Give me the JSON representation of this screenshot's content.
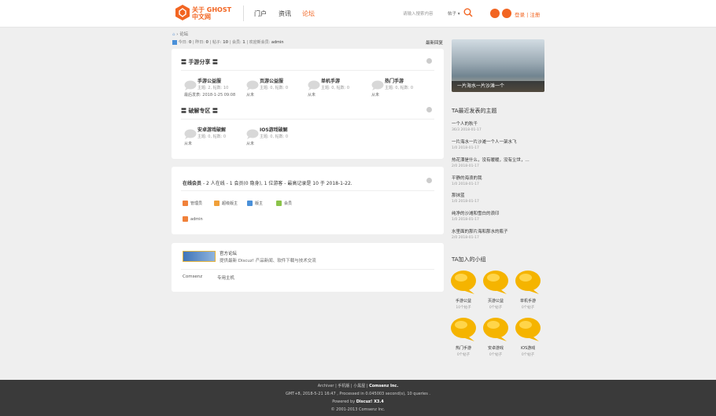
{
  "header": {
    "logo_line1": "关于 GHOST",
    "logo_line2": "中文网",
    "nav": [
      "门户",
      "资讯",
      "论坛"
    ],
    "search_placeholder": "请输入搜索内容",
    "search_scope": "帖子",
    "login": "登录",
    "register": "注册"
  },
  "breadcrumb": {
    "current": "论坛"
  },
  "stats": {
    "today_label": "今日:",
    "today": "0",
    "yesterday_label": "昨日:",
    "yesterday": "0",
    "posts_label": "帖子:",
    "posts": "10",
    "members_label": "会员:",
    "members": "1",
    "welcome_label": "欢迎新会员:",
    "newest": "admin"
  },
  "latest_reply": "最新回复",
  "categories": [
    {
      "title": "手游分享",
      "forums": [
        {
          "name": "手游公益服",
          "stat": "主题: 2, 帖数: 10",
          "extra": "最后发表: 2018-1-25 09:08"
        },
        {
          "name": "页游公益服",
          "stat": "主题: 0, 帖数: 0",
          "extra": "从未"
        },
        {
          "name": "单机手游",
          "stat": "主题: 0, 帖数: 0",
          "extra": "从未"
        },
        {
          "name": "热门手游",
          "stat": "主题: 0, 帖数: 0",
          "extra": "从未"
        }
      ]
    },
    {
      "title": "破解专区",
      "forums": [
        {
          "name": "安卓游戏破解",
          "stat": "主题: 0, 帖数: 0",
          "extra": "从未"
        },
        {
          "name": "IOS游戏破解",
          "stat": "主题: 0, 帖数: 0",
          "extra": "从未"
        }
      ]
    }
  ],
  "online": {
    "prefix": "在线会员",
    "summary": "- 2 人在线 - 1 会员(0 隐身), 1 位游客 - 最高记录是 10 于 2018-1-22.",
    "legend": [
      "管理员",
      "超级版主",
      "版主",
      "会员"
    ],
    "legend_colors": [
      "#f0813a",
      "#f0a03a",
      "#4a90d9",
      "#8bc34a"
    ],
    "users": [
      "admin"
    ]
  },
  "links": {
    "featured_title": "官方论坛",
    "featured_desc": "提供最新 Discuz! 产品新闻、软件下载与技术交流",
    "text_links": [
      "Comsenz",
      "专用主机"
    ]
  },
  "sidebar": {
    "photo_caption": "一片海水一片沙滩一个",
    "recent_title": "TA最近发表的主题",
    "threads": [
      {
        "title": "一个人的秋千",
        "meta": "36/3 2018-01-17"
      },
      {
        "title": "一片海水一片沙滩一个人一架水飞",
        "meta": "1/0 2018-01-17"
      },
      {
        "title": "热花漂是什么，没有暖暖，没有尘世，...",
        "meta": "2/0 2018-01-17"
      },
      {
        "title": "平静的海浪的我",
        "meta": "1/0 2018-01-17"
      },
      {
        "title": "那抹蓝",
        "meta": "1/0 2018-01-17"
      },
      {
        "title": "纯净的沙滩和雪白的浪印",
        "meta": "1/0 2018-01-17"
      },
      {
        "title": "水里面的那片海和那水的瓶子",
        "meta": "2/0 2018-01-17"
      }
    ],
    "groups_title": "TA加入的小组",
    "groups": [
      {
        "name": "手游公益",
        "count": "10个帖子"
      },
      {
        "name": "页游公益",
        "count": "0个帖子"
      },
      {
        "name": "单机手游",
        "count": "0个帖子"
      },
      {
        "name": "热门手游",
        "count": "0个帖子"
      },
      {
        "name": "安卓游戏",
        "count": "0个帖子"
      },
      {
        "name": "iOS游戏",
        "count": "0个帖子"
      }
    ]
  },
  "footer": {
    "links": "Archiver | 手机版 | 小黑屋 |",
    "company": "Comsenz Inc.",
    "perf": "GMT+8, 2018-5-21 16:47 , Processed in 0.045003 second(s), 10 queries .",
    "powered_prefix": "Powered by",
    "powered": "Discuz! X3.4",
    "copyright": "© 2001-2013 Comsenz Inc."
  },
  "colors": {
    "accent": "#f26522",
    "footer_bg": "#3a3a3a"
  }
}
